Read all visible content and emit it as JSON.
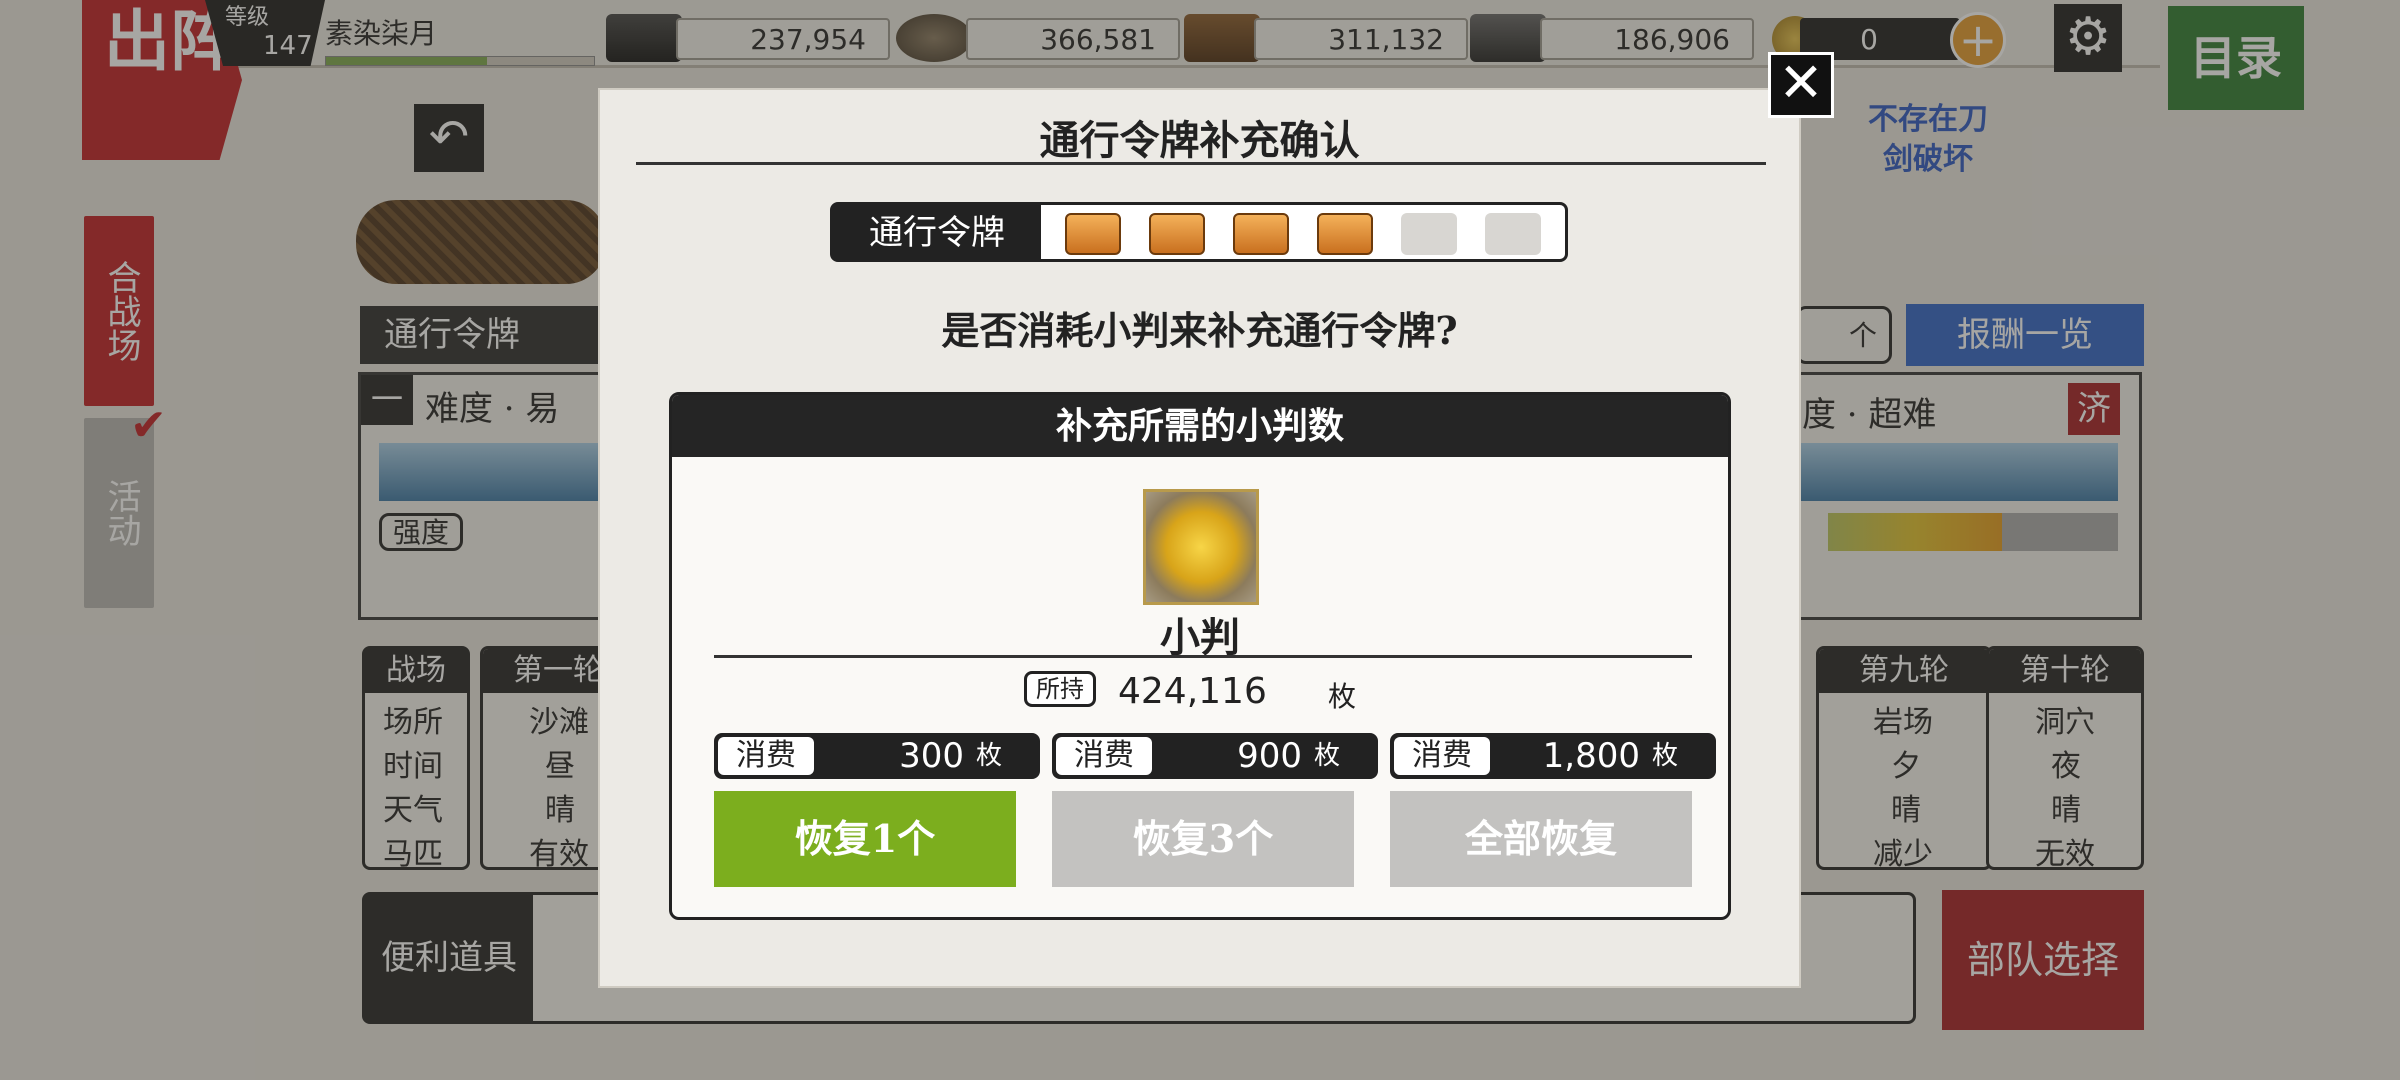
{
  "header": {
    "sortie_label": "出阵",
    "level_label": "等级",
    "level_value": "147",
    "player_name": "素染柒月",
    "exp_fraction": 0.6,
    "resources": [
      {
        "name": "charcoal-icon",
        "value": "237,954"
      },
      {
        "name": "steel-icon",
        "value": "366,581"
      },
      {
        "name": "coolant-icon",
        "value": "311,132"
      },
      {
        "name": "whetstone-icon",
        "value": "186,906"
      }
    ],
    "coin_value": "0",
    "menu_label": "目录"
  },
  "sidebar": {
    "battle_label": "合战场",
    "event_label": "活动"
  },
  "background": {
    "pass_label": "通行令牌",
    "difficulty_easy": "难度 · 易",
    "difficulty_hard": "度 · 超难",
    "difficulty_index": "一",
    "strength_label": "强度",
    "cleared_badge": "济",
    "rewards_button": "报酬一览",
    "count_unit": "个",
    "no_break_notice": "不存在刀剑破坏",
    "left_table": {
      "header": "战场",
      "rows": [
        "场所",
        "时间",
        "天气",
        "马匹"
      ]
    },
    "round1": {
      "header": "第一轮",
      "rows": [
        "沙滩",
        "昼",
        "晴",
        "有效"
      ]
    },
    "round9": {
      "header": "第九轮",
      "rows": [
        "岩场",
        "夕",
        "晴",
        "减少"
      ]
    },
    "round10": {
      "header": "第十轮",
      "rows": [
        "洞穴",
        "夜",
        "晴",
        "无效"
      ]
    },
    "items_label": "便利道具",
    "squad_button": "部队选择"
  },
  "modal": {
    "title": "通行令牌补充确认",
    "pass_label": "通行令牌",
    "pass_filled": 4,
    "pass_total": 6,
    "question": "是否消耗小判来补充通行令牌?",
    "section_title": "补充所需的小判数",
    "coin_name": "小判",
    "held_label": "所持",
    "held_value": "424,116",
    "unit": "枚",
    "costs": [
      {
        "tag": "消费",
        "value": "300",
        "unit": "枚",
        "action": "恢复1个"
      },
      {
        "tag": "消费",
        "value": "900",
        "unit": "枚",
        "action": "恢复3个"
      },
      {
        "tag": "消费",
        "value": "1,800",
        "unit": "枚",
        "action": "全部恢复"
      }
    ]
  },
  "colors": {
    "accent_red": "#c01d22",
    "menu_green": "#2c7a2e",
    "action_green": "#7cae1e",
    "disabled_grey": "#c3c2c0",
    "rewards_blue": "#2f63c7"
  }
}
